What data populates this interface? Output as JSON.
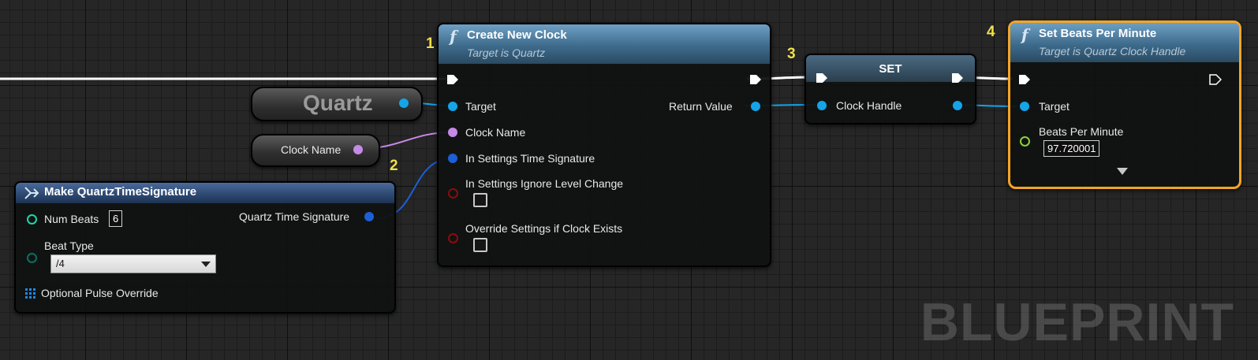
{
  "watermark": "BLUEPRINT",
  "steps": [
    "1",
    "2",
    "3",
    "4"
  ],
  "quartz_ref": {
    "label": "Quartz"
  },
  "clock_name_ref": {
    "label": "Clock Name"
  },
  "make_sig": {
    "title": "Make QuartzTimeSignature",
    "num_beats_label": "Num Beats",
    "num_beats_value": "6",
    "beat_type_label": "Beat Type",
    "beat_type_value": "/4",
    "pulse_label": "Optional Pulse Override",
    "output_label": "Quartz Time Signature"
  },
  "create_clock": {
    "icon": "f",
    "title": "Create New Clock",
    "subtitle": "Target is Quartz",
    "target_label": "Target",
    "return_label": "Return Value",
    "clock_name_label": "Clock Name",
    "time_sig_label": "In Settings Time Signature",
    "ignore_label": "In Settings Ignore Level Change",
    "override_label": "Override Settings if Clock Exists"
  },
  "set_node": {
    "title": "SET",
    "clock_handle_label": "Clock Handle"
  },
  "set_bpm": {
    "icon": "f",
    "title": "Set Beats Per Minute",
    "subtitle": "Target is Quartz Clock Handle",
    "target_label": "Target",
    "bpm_label": "Beats Per Minute",
    "bpm_value": "97.720001"
  },
  "colors": {
    "exec_wire": "#ffffff",
    "object_pin": "#14a4e8",
    "struct_pin": "#1c5fd6",
    "name_pin": "#c58ae6",
    "bool_pin": "#8a0c0c",
    "float_pin": "#8ad33a",
    "int_pin": "#1fd6a4",
    "byte_pin": "#0d6e60",
    "selected_outline": "#f5a524"
  }
}
